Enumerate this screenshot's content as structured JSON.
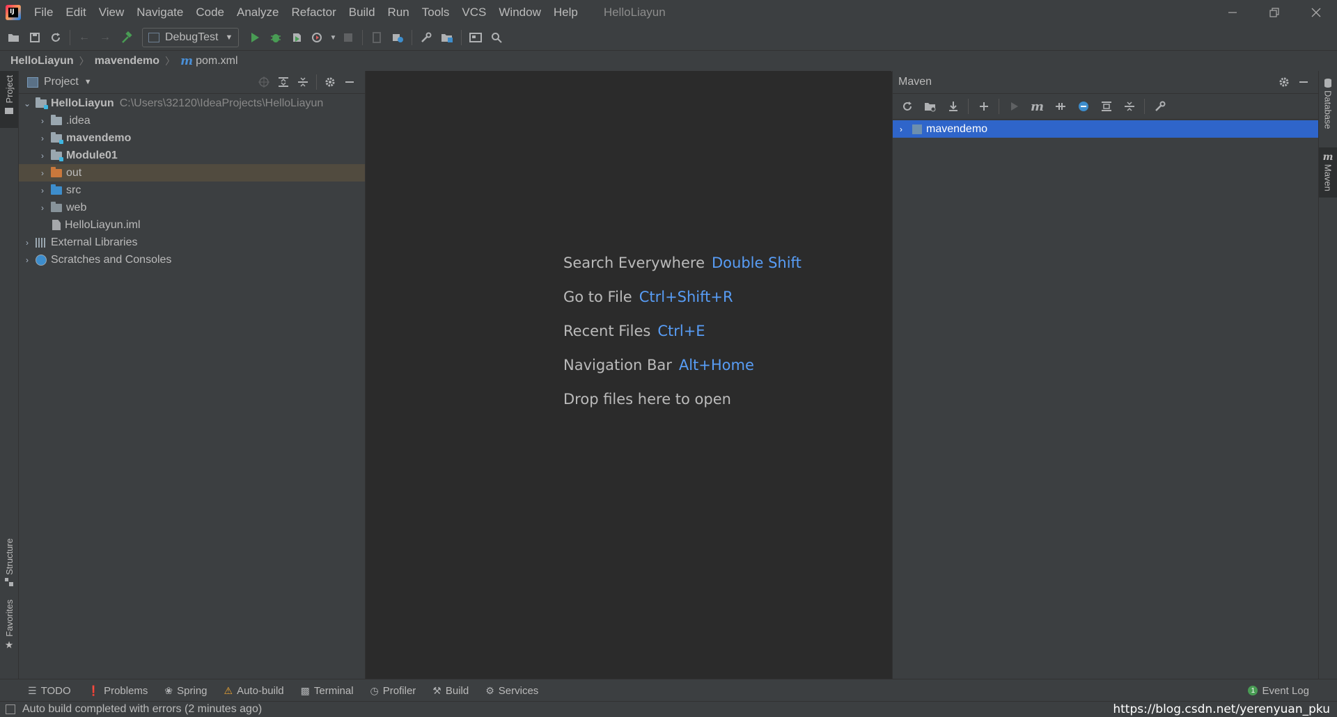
{
  "app": {
    "logo_text": "IJ",
    "window_title": "HelloLiayun",
    "menu": [
      "File",
      "Edit",
      "View",
      "Navigate",
      "Code",
      "Analyze",
      "Refactor",
      "Build",
      "Run",
      "Tools",
      "VCS",
      "Window",
      "Help"
    ]
  },
  "toolbar": {
    "run_config": "DebugTest"
  },
  "breadcrumb": {
    "project": "HelloLiayun",
    "module": "mavendemo",
    "file": "pom.xml",
    "file_icon": "m"
  },
  "left_stripe": {
    "project_tab": "Project",
    "structure_tab": "Structure",
    "favorites_tab": "Favorites"
  },
  "right_stripe": {
    "database_tab": "Database",
    "maven_tab": "Maven"
  },
  "project_panel": {
    "title": "Project",
    "tree": {
      "root": {
        "name": "HelloLiayun",
        "path": "C:\\Users\\32120\\IdeaProjects\\HelloLiayun"
      },
      "items": [
        {
          "name": ".idea"
        },
        {
          "name": "mavendemo"
        },
        {
          "name": "Module01"
        },
        {
          "name": "out"
        },
        {
          "name": "src"
        },
        {
          "name": "web"
        },
        {
          "name": "HelloLiayun.iml"
        }
      ],
      "external_libraries": "External Libraries",
      "scratches": "Scratches and Consoles"
    }
  },
  "editor": {
    "hints": [
      {
        "label": "Search Everywhere",
        "key": "Double Shift"
      },
      {
        "label": "Go to File",
        "key": "Ctrl+Shift+R"
      },
      {
        "label": "Recent Files",
        "key": "Ctrl+E"
      },
      {
        "label": "Navigation Bar",
        "key": "Alt+Home"
      },
      {
        "label": "Drop files here to open",
        "key": ""
      }
    ]
  },
  "maven_panel": {
    "title": "Maven",
    "projects": [
      {
        "name": "mavendemo"
      }
    ],
    "m_icon": "m"
  },
  "bottom_bar": {
    "tabs": [
      "TODO",
      "Problems",
      "Spring",
      "Auto-build",
      "Terminal",
      "Profiler",
      "Build",
      "Services"
    ],
    "event_log": "Event Log",
    "event_count": "1"
  },
  "status_bar": {
    "text": "Auto build completed with errors (2 minutes ago)",
    "watermark": "https://blog.csdn.net/yerenyuan_pku"
  },
  "colors": {
    "background": "#2b2b2b",
    "panel": "#3c3f41",
    "selection_row": "#514b3f",
    "maven_selection": "#2f65ca",
    "shortcut_key": "#589df6",
    "run_green": "#499c54"
  }
}
